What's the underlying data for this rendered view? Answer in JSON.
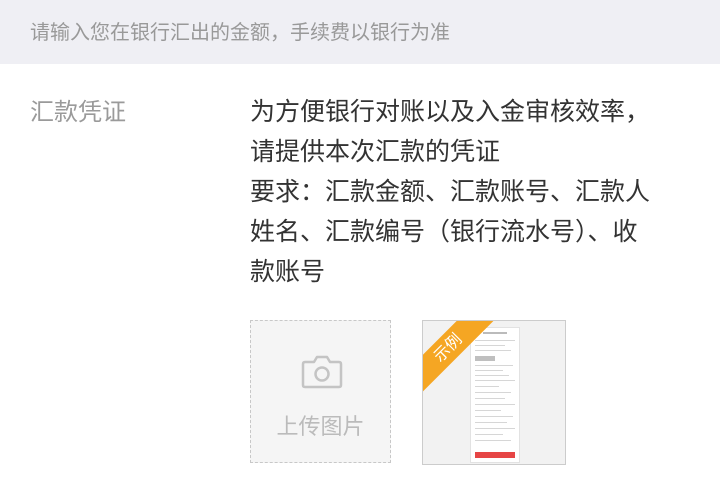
{
  "notice": {
    "text": "请输入您在银行汇出的金额，手续费以银行为准"
  },
  "voucher": {
    "label": "汇款凭证",
    "description_lines": [
      "为方便银行对账以及入金审核效率，",
      "请提供本次汇款的凭证",
      "要求：汇款金额、汇款账号、汇款人",
      "姓名、汇款编号（银行流水号）、收",
      "款账号"
    ],
    "upload": {
      "label": "上传图片",
      "icon": "camera-icon"
    },
    "sample": {
      "ribbon_label": "示例"
    }
  },
  "colors": {
    "notice_bg": "#efeff4",
    "ribbon": "#f5a623",
    "sample_button": "#e64545"
  }
}
